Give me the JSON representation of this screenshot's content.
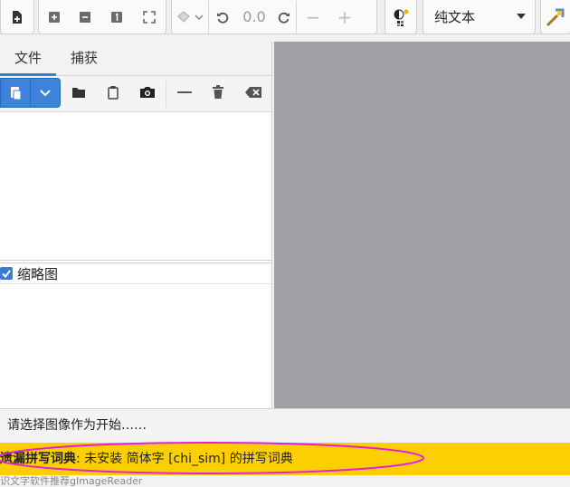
{
  "toolbar": {
    "rotation_value": "0.0",
    "zoom_out_symbol": "−",
    "zoom_in_symbol": "+",
    "output_mode": "纯文本"
  },
  "tabs": [
    {
      "label": "文件"
    },
    {
      "label": "捕获"
    }
  ],
  "thumbnails": {
    "label": "缩略图",
    "checked": true
  },
  "status": {
    "message": "请选择图像作为开始……"
  },
  "banner": {
    "bold_prefix": "遗漏拼写词典",
    "message": ": 未安装 简体字 [chi_sim] 的拼写词典"
  },
  "footer": {
    "text": "识文字软件推荐gImageReader"
  },
  "colors": {
    "accent": "#3d82db",
    "banner_bg": "#fcd000",
    "canvas_bg": "#a09fa4",
    "annotation": "#e020e0"
  }
}
